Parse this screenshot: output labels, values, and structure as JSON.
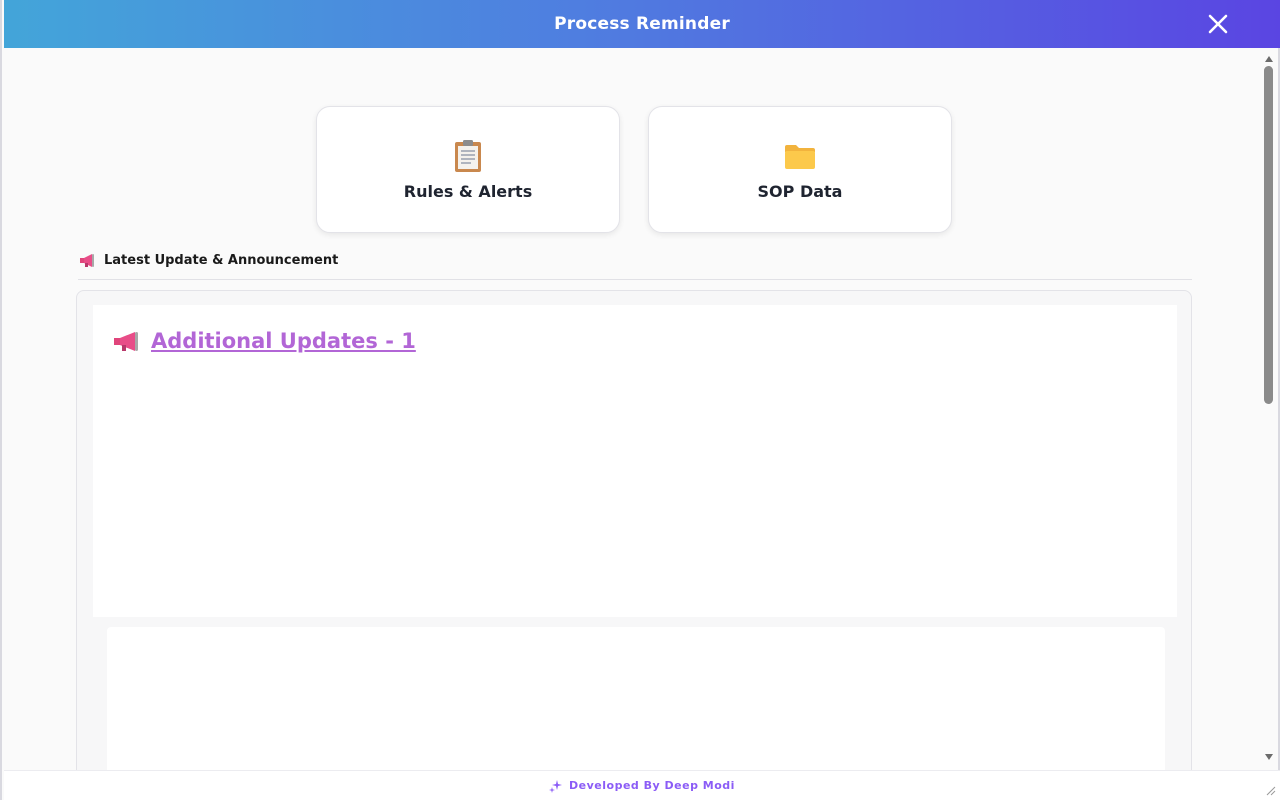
{
  "window": {
    "title": "Process Reminder"
  },
  "cards": [
    {
      "label": "Rules & Alerts",
      "icon": "clipboard-icon"
    },
    {
      "label": "SOP Data",
      "icon": "folder-icon"
    }
  ],
  "announcements": {
    "heading": "Latest Update & Announcement",
    "updates": [
      {
        "title": "Additional Updates - 1",
        "icon": "megaphone-icon"
      }
    ]
  },
  "footer": {
    "credit": "Developed By Deep Modi",
    "icon": "sparkle-icon"
  },
  "colors": {
    "header_gradient_start": "#43a5d9",
    "header_gradient_end": "#5a45e2",
    "update_link": "#b266d6",
    "footer_text": "#8b5cf6"
  }
}
